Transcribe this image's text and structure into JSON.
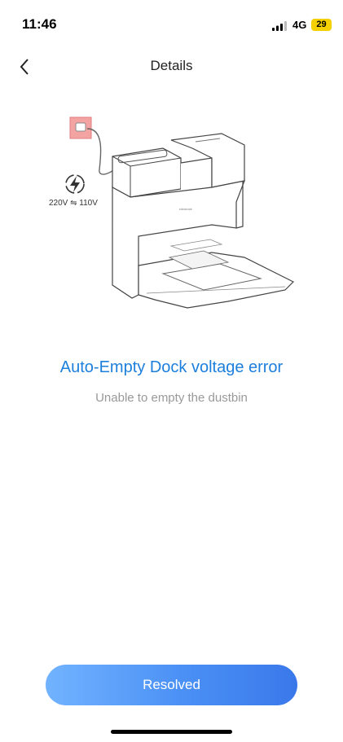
{
  "status_bar": {
    "time": "11:46",
    "network": "4G",
    "battery": "29"
  },
  "header": {
    "title": "Details",
    "back_icon": "chevron-left-icon"
  },
  "illustration": {
    "voltage_label": "220V ⇋ 110V",
    "icon": "lightning-icon",
    "accent_color": "#f4a3a3"
  },
  "error": {
    "title": "Auto-Empty Dock voltage error",
    "subtitle": "Unable to empty the dustbin",
    "title_color": "#1d7fdc"
  },
  "actions": {
    "resolved_label": "Resolved"
  }
}
